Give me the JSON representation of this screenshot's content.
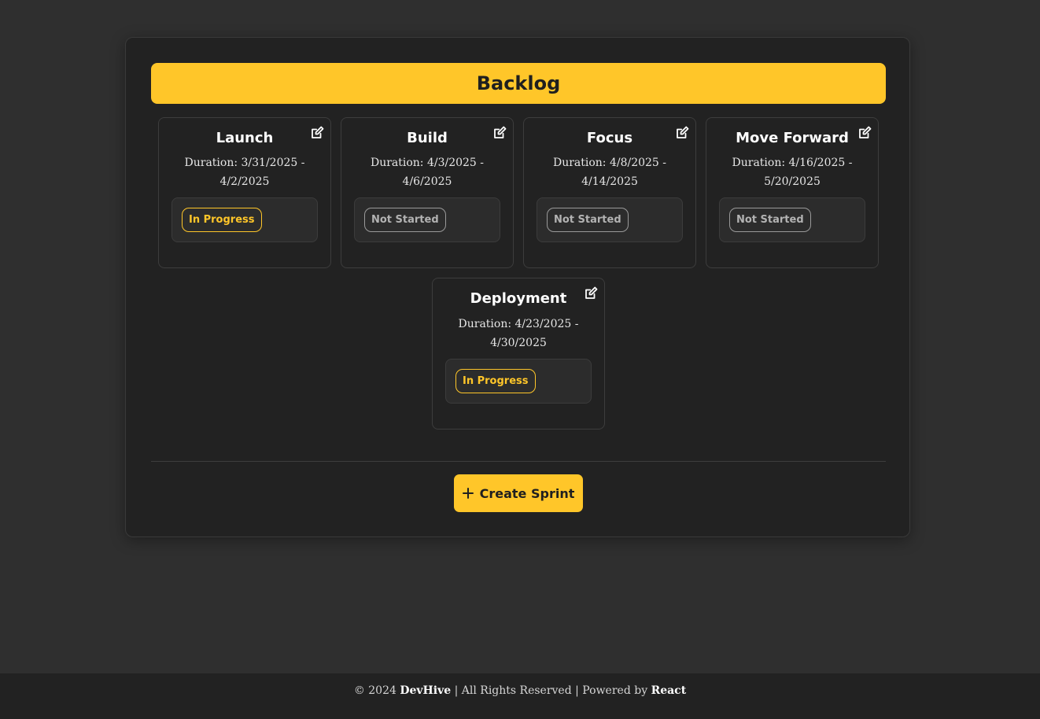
{
  "board": {
    "title": "Backlog",
    "create_button_label": "Create Sprint"
  },
  "sprints": [
    {
      "name": "Launch",
      "duration_line1": "Duration: 3/31/2025 -",
      "duration_line2": "4/2/2025",
      "status": "In Progress"
    },
    {
      "name": "Build",
      "duration_line1": "Duration: 4/3/2025 -",
      "duration_line2": "4/6/2025",
      "status": "Not Started"
    },
    {
      "name": "Focus",
      "duration_line1": "Duration: 4/8/2025 -",
      "duration_line2": "4/14/2025",
      "status": "Not Started"
    },
    {
      "name": "Move Forward",
      "duration_line1": "Duration: 4/16/2025 -",
      "duration_line2": "5/20/2025",
      "status": "Not Started"
    },
    {
      "name": "Deployment",
      "duration_line1": "Duration: 4/23/2025 -",
      "duration_line2": "4/30/2025",
      "status": "In Progress"
    }
  ],
  "footer": {
    "copyright": "© 2024",
    "brand": "DevHive",
    "rights": "| All Rights Reserved | Powered by",
    "powered_by": "React"
  },
  "colors": {
    "accent": "#ffc629",
    "page_background": "#2f2f2f",
    "panel_background": "#222222"
  },
  "icons": {
    "edit": "edit-icon",
    "plus": "plus-icon"
  }
}
